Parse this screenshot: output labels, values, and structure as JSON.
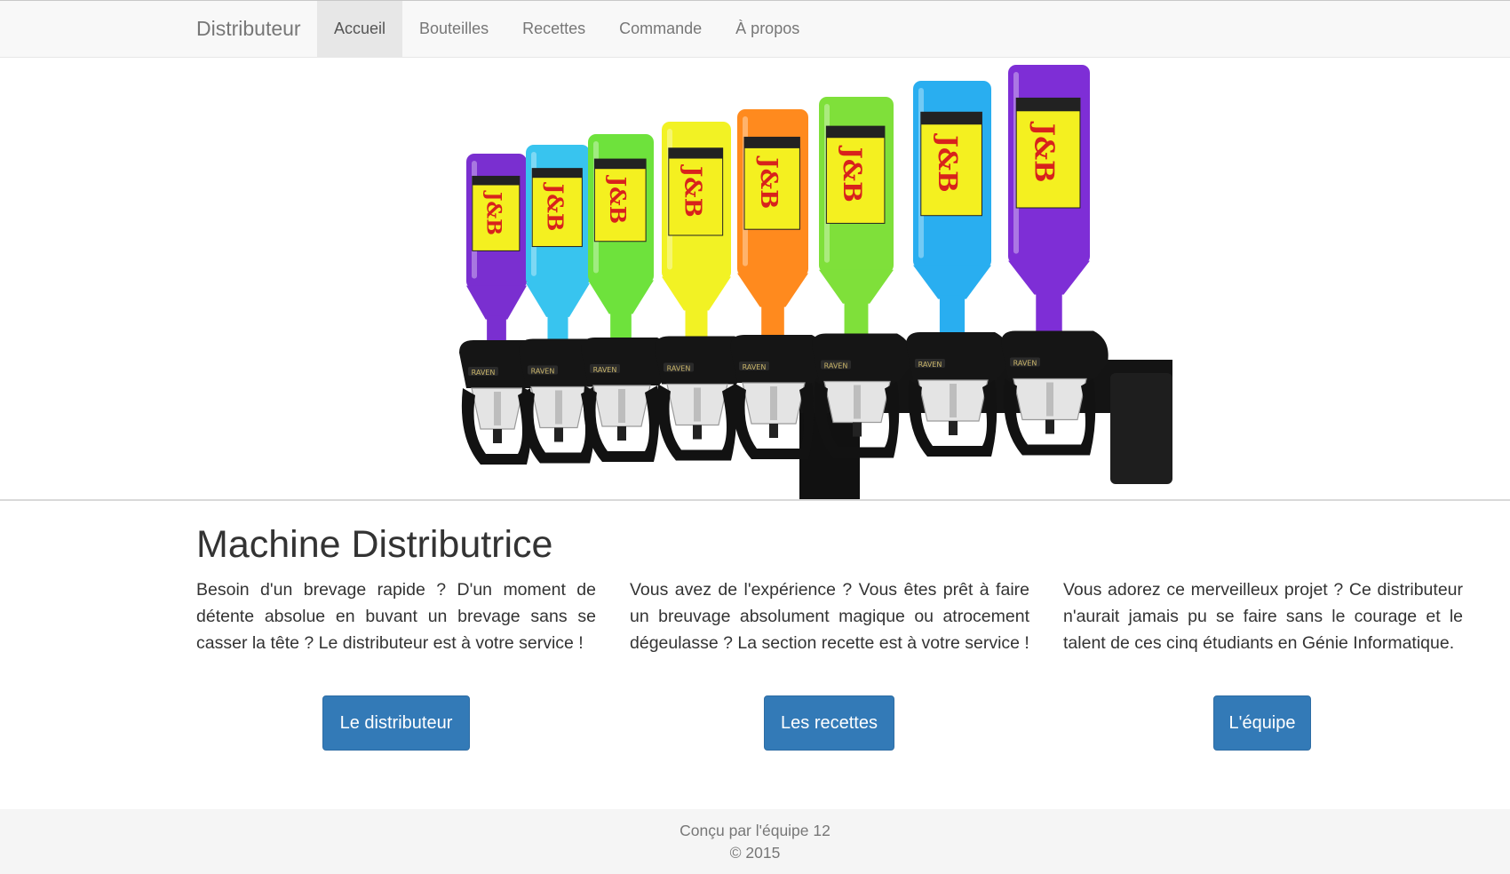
{
  "navbar": {
    "brand": "Distributeur",
    "items": [
      {
        "label": "Accueil",
        "active": true
      },
      {
        "label": "Bouteilles",
        "active": false
      },
      {
        "label": "Recettes",
        "active": false
      },
      {
        "label": "Commande",
        "active": false
      },
      {
        "label": "À propos",
        "active": false
      }
    ]
  },
  "hero": {
    "bottle_colors": [
      "#7a2fd0",
      "#38c4ef",
      "#6ee23c",
      "#f2f224",
      "#ff8a1e",
      "#7fe03a",
      "#29aef0",
      "#7e2ed6"
    ],
    "label_color": "#f4f020",
    "label_brand_color": "#d8221c",
    "label_text": "J&B",
    "dispenser_label": "RAVEN"
  },
  "main": {
    "title": "Machine Distributrice",
    "columns": [
      {
        "text": "Besoin d'un brevage rapide ? D'un moment de détente absolue en buvant un brevage sans se casser la tête ? Le distributeur est à votre service !",
        "button": "Le distributeur"
      },
      {
        "text": "Vous avez de l'expérience ? Vous êtes prêt à faire un breuvage absolument magique ou atrocement dégeulasse ? La section recette est à votre service !",
        "button": "Les recettes"
      },
      {
        "text": "Vous adorez ce merveilleux projet ? Ce distributeur n'aurait jamais pu se faire sans le courage et le talent de ces cinq étudiants en Génie Informatique.",
        "button": "L'équipe"
      }
    ]
  },
  "footer": {
    "line1": "Conçu par l'équipe 12",
    "line2": "© 2015"
  },
  "colors": {
    "primary": "#337ab7",
    "navbar_bg": "#f8f8f8",
    "footer_bg": "#f5f5f5"
  }
}
